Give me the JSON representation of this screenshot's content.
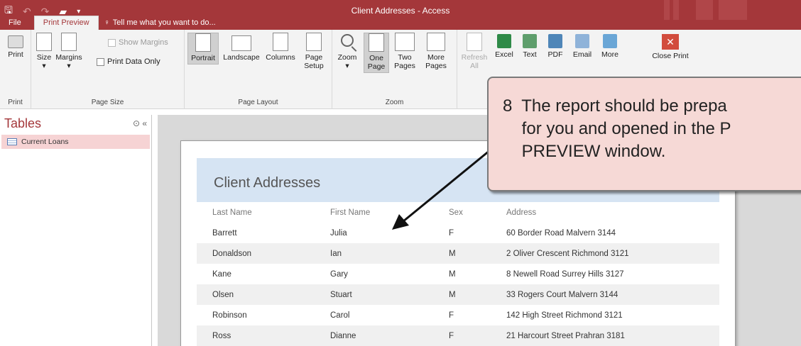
{
  "window": {
    "title": "Client Addresses - Access"
  },
  "tabs": {
    "file": "File",
    "print_preview": "Print Preview",
    "tell_me": "Tell me what you want to do..."
  },
  "ribbon": {
    "print": {
      "label": "Print",
      "group": "Print"
    },
    "page_size": {
      "size": "Size",
      "margins": "Margins",
      "show_margins": "Show Margins",
      "print_data_only": "Print Data Only",
      "group": "Page Size"
    },
    "page_layout": {
      "portrait": "Portrait",
      "landscape": "Landscape",
      "columns": "Columns",
      "page_setup_1": "Page",
      "page_setup_2": "Setup",
      "group": "Page Layout"
    },
    "zoom": {
      "zoom": "Zoom",
      "one_page_1": "One",
      "one_page_2": "Page",
      "two_pages_1": "Two",
      "two_pages_2": "Pages",
      "more_pages_1": "More",
      "more_pages_2": "Pages",
      "group": "Zoom"
    },
    "data": {
      "refresh_1": "Refresh",
      "refresh_2": "All",
      "excel": "Excel",
      "text": "Text",
      "pdf": "PDF",
      "email": "Email",
      "more": "More"
    },
    "close": {
      "label": "Close Print"
    }
  },
  "nav": {
    "title": "Tables",
    "controls": "⊙ «",
    "items": [
      {
        "label": "Current Loans"
      }
    ]
  },
  "report": {
    "title": "Client Addresses",
    "columns": [
      "Last Name",
      "First Name",
      "Sex",
      "Address"
    ],
    "rows": [
      [
        "Barrett",
        "Julia",
        "F",
        "60 Border Road Malvern 3144"
      ],
      [
        "Donaldson",
        "Ian",
        "M",
        "2 Oliver Crescent Richmond 3121"
      ],
      [
        "Kane",
        "Gary",
        "M",
        "8 Newell Road Surrey Hills 3127"
      ],
      [
        "Olsen",
        "Stuart",
        "M",
        "33 Rogers Court Malvern 3144"
      ],
      [
        "Robinson",
        "Carol",
        "F",
        "142 High Street Richmond 3121"
      ],
      [
        "Ross",
        "Dianne",
        "F",
        "21 Harcourt Street Prahran 3181"
      ]
    ]
  },
  "callout": {
    "line1": "8  The report should be prepa",
    "line2": "    for you and opened in the P",
    "line3": "    PREVIEW window."
  },
  "colors": {
    "accent": "#a4373a",
    "header_band": "#d6e4f3",
    "callout_fill": "#f6d9d6"
  }
}
